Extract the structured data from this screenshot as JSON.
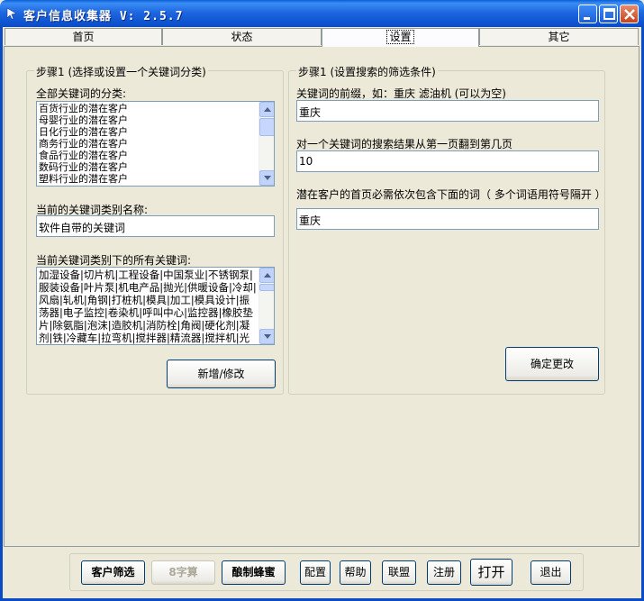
{
  "window": {
    "title": "客户信息收集器 V: 2.5.7"
  },
  "tabs": [
    {
      "label": "首页"
    },
    {
      "label": "状态"
    },
    {
      "label": "设置"
    },
    {
      "label": "其它"
    }
  ],
  "left_group": {
    "title": "步骤1 (选择或设置一个关键词分类)",
    "all_categories_label": "全部关键词的分类:",
    "categories": [
      "百货行业的潜在客户",
      "母婴行业的潜在客户",
      "日化行业的潜在客户",
      "商务行业的潜在客户",
      "食品行业的潜在客户",
      "数码行业的潜在客户",
      "塑料行业的潜在客户"
    ],
    "current_category_label": "当前的关键词类别名称:",
    "current_category_value": "软件自带的关键词",
    "keywords_label": "当前关键词类别下的所有关键词:",
    "keywords_text": "加湿设备|切片机|工程设备|中国泵业|不锈钢泵|服装设备|叶片泵|机电产品|抛光|供暖设备|冷却|风扇|轧机|角钢|打桩机|模具|加工|模具设计|振荡器|电子监控|卷染机|呼叫中心|监控器|橡胶垫片|除氨脂|泡沫|造胶机|消防栓|角阀|硬化剂|凝剂|铁|冷藏车|拉弯机|搅拌器|精流器|搅拌机|光度",
    "add_edit_button": "新增/修改"
  },
  "right_group": {
    "title": "步骤1 (设置搜索的筛选条件)",
    "prefix_label": "关键词的前缀，如：重庆 滤油机 (可以为空)",
    "prefix_value": "重庆",
    "pages_label": "对一个关键词的搜索结果从第一页翻到第几页",
    "pages_value": "10",
    "must_contain_label": "潜在客户的首页必需依次包含下面的词（ 多个词语用符号隔开 ）",
    "must_contain_value": "重庆",
    "confirm_button": "确定更改"
  },
  "bottom_toolbar": {
    "buttons": [
      {
        "label": "客户筛选",
        "style": "bold"
      },
      {
        "label": "8字算",
        "style": "disabled"
      },
      {
        "label": "酿制蜂蜜",
        "style": "bold"
      },
      {
        "label": "配置",
        "style": "normal"
      },
      {
        "label": "帮助",
        "style": "normal"
      },
      {
        "label": "联盟",
        "style": "normal"
      },
      {
        "label": "注册",
        "style": "normal"
      },
      {
        "label": "打开",
        "style": "large"
      },
      {
        "label": "退出",
        "style": "normal"
      }
    ]
  },
  "colors": {
    "titlebar": "#0b4cc4",
    "face": "#ece9d8",
    "input_border": "#7f9db9"
  }
}
